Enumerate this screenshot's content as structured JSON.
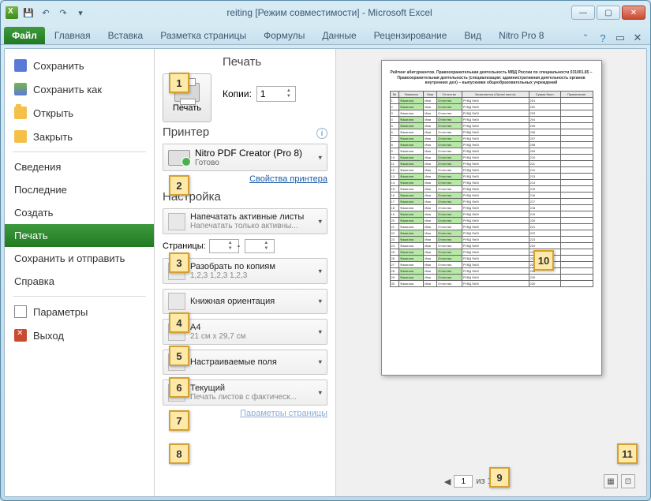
{
  "title": "reiting  [Режим совместимости]  -  Microsoft Excel",
  "tabs": {
    "file": "Файл",
    "home": "Главная",
    "insert": "Вставка",
    "layout": "Разметка страницы",
    "formulas": "Формулы",
    "data": "Данные",
    "review": "Рецензирование",
    "view": "Вид",
    "nitro": "Nitro Pro 8"
  },
  "left": {
    "save": "Сохранить",
    "saveas": "Сохранить как",
    "open": "Открыть",
    "close": "Закрыть",
    "info": "Сведения",
    "recent": "Последние",
    "new": "Создать",
    "print": "Печать",
    "share": "Сохранить и отправить",
    "help": "Справка",
    "options": "Параметры",
    "exit": "Выход"
  },
  "print": {
    "heading": "Печать",
    "btn": "Печать",
    "copies_label": "Копии:",
    "copies_value": "1",
    "printer_heading": "Принтер",
    "printer_name": "Nitro PDF Creator (Pro 8)",
    "printer_status": "Готово",
    "printer_props": "Свойства принтера",
    "settings_heading": "Настройка",
    "opt_active": "Напечатать активные листы",
    "opt_active_sub": "Напечатать только активны...",
    "pages_label": "Страницы:",
    "pages_sep": "-",
    "opt_collate": "Разобрать по копиям",
    "opt_collate_sub": "1,2,3   1,2,3   1,2,3",
    "opt_orient": "Книжная ориентация",
    "opt_size": "A4",
    "opt_size_sub": "21 см x 29,7 см",
    "opt_margins": "Настраиваемые поля",
    "opt_scale": "Текущий",
    "opt_scale_sub": "Печать листов с фактическ...",
    "page_params": "Параметры страницы"
  },
  "nav": {
    "page_val": "1",
    "of": "из 1"
  },
  "callouts": {
    "c1": "1",
    "c2": "2",
    "c3": "3",
    "c4": "4",
    "c5": "5",
    "c6": "6",
    "c7": "7",
    "c8": "8",
    "c9": "9",
    "c10": "10",
    "c11": "11"
  }
}
